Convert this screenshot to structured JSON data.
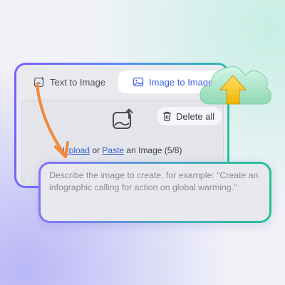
{
  "tabs": {
    "text_to_image": "Text to Image",
    "image_to_image": "Image to Image"
  },
  "upload": {
    "delete_all": "Delete all",
    "upload_link": "Upload",
    "or": "or",
    "paste_link": "Paste",
    "suffix": "an Image (5/8)"
  },
  "prompt": {
    "placeholder": "Describe the image to create, for example: \"Create an infographic calling for action on global warming.\""
  },
  "colors": {
    "accent_blue": "#3d5fe0",
    "gradient_purple": "#7b5cff",
    "gradient_green": "#22c7a0",
    "arrow_orange": "#f08a3c",
    "cloud_green": "#a8e6cf",
    "upload_arrow_yellow": "#f5c518"
  },
  "icons": {
    "text_tab": "sparkle-image-icon",
    "image_tab": "image-swap-icon",
    "upload": "image-upload-icon",
    "delete": "trash-icon",
    "cloud": "cloud-upload-icon",
    "flow": "curved-arrow-icon"
  }
}
